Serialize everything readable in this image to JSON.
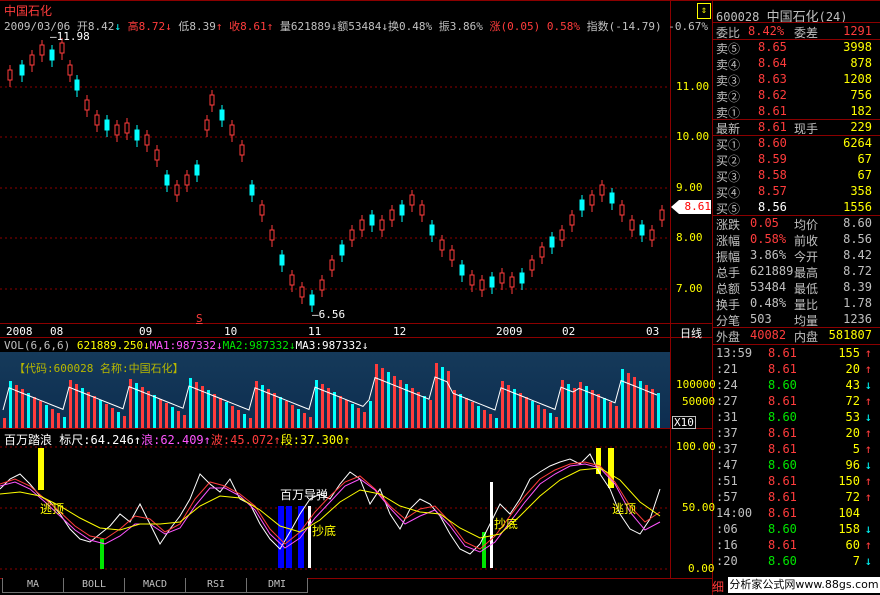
{
  "stock": {
    "name": "中国石化",
    "code": "600028",
    "title_right": "600028 中国石化(24)"
  },
  "info_bar": {
    "date": "2009/03/06",
    "open_label": "开",
    "open": "8.42",
    "high_label": "高",
    "high": "8.72",
    "low_label": "低",
    "low": "8.39",
    "close_label": "收",
    "close": "8.61",
    "vol_label": "量",
    "vol": "621889",
    "amount_label": "额",
    "amount": "53484",
    "turnover_label": "换",
    "turnover": "0.48%",
    "amplitude_label": "振",
    "amplitude": "3.86%",
    "change_label": "涨",
    "change": "(0.05)",
    "change_pct": "0.58%",
    "index_label": "指数",
    "index": "(-14.79)",
    "index_pct": "-0.67%"
  },
  "price_axis": [
    "11.00",
    "10.00",
    "9.00",
    "8.00",
    "7.00"
  ],
  "price_tag": "8.61",
  "annotations": {
    "max": "11.98",
    "min": "6.56",
    "s_mark": "S"
  },
  "date_axis": [
    "2008",
    "08",
    "09",
    "10",
    "11",
    "12",
    "2009",
    "02",
    "03"
  ],
  "period_label": "日线",
  "volume_header": {
    "title": "VOL(6,6,6)",
    "vol": "621889.250",
    "ma1_label": "MA1:",
    "ma1": "987332",
    "ma2_label": "MA2:",
    "ma2": "987332",
    "ma3_label": "MA3:",
    "ma3": "987332"
  },
  "volume_banner": "【代码:600028 名称:中国石化】",
  "volume_axis": [
    "100000",
    "50000"
  ],
  "volume_unit": "X10",
  "indicator_header": {
    "name": "百万踏浪",
    "ruler_label": "标尺:",
    "ruler": "64.246",
    "wave1_label": "浪:",
    "wave1": "62.409",
    "wave2_label": "波:",
    "wave2": "45.072",
    "seg_label": "段:",
    "seg": "37.300"
  },
  "indicator_axis": [
    "100.00",
    "50.00",
    "0.00"
  ],
  "indicator_labels": {
    "top_sell1": "逃顶",
    "mid_buy1": "百万导弹",
    "bottom1": "抄底",
    "bottom2": "抄底",
    "top_sell2": "逃顶"
  },
  "tabs": [
    "MA",
    "BOLL",
    "MACD",
    "RSI",
    "DMI"
  ],
  "order_book": {
    "ratio_label": "委比",
    "ratio": "8.42%",
    "diff_label": "委差",
    "diff": "1291",
    "asks": [
      {
        "label": "卖⑤",
        "price": "8.65",
        "vol": "3998"
      },
      {
        "label": "卖④",
        "price": "8.64",
        "vol": "878"
      },
      {
        "label": "卖③",
        "price": "8.63",
        "vol": "1208"
      },
      {
        "label": "卖②",
        "price": "8.62",
        "vol": "756"
      },
      {
        "label": "卖①",
        "price": "8.61",
        "vol": "182"
      }
    ],
    "last_label": "最新",
    "last": "8.61",
    "hand_label": "现手",
    "hand": "229",
    "bids": [
      {
        "label": "买①",
        "price": "8.60",
        "vol": "6264"
      },
      {
        "label": "买②",
        "price": "8.59",
        "vol": "67"
      },
      {
        "label": "买③",
        "price": "8.58",
        "vol": "67"
      },
      {
        "label": "买④",
        "price": "8.57",
        "vol": "358"
      },
      {
        "label": "买⑤",
        "price": "8.56",
        "vol": "1556"
      }
    ]
  },
  "stats": [
    {
      "l1": "涨跌",
      "v1": "0.05",
      "l2": "均价",
      "v2": "8.60"
    },
    {
      "l1": "涨幅",
      "v1": "0.58%",
      "l2": "前收",
      "v2": "8.56"
    },
    {
      "l1": "振幅",
      "v1": "3.86%",
      "l2": "今开",
      "v2": "8.42"
    },
    {
      "l1": "总手",
      "v1": "621889",
      "l2": "最高",
      "v2": "8.72"
    },
    {
      "l1": "总额",
      "v1": "53484",
      "l2": "最低",
      "v2": "8.39"
    },
    {
      "l1": "换手",
      "v1": "0.48%",
      "l2": "量比",
      "v2": "1.78"
    },
    {
      "l1": "分笔",
      "v1": "503",
      "l2": "均量",
      "v2": "1236"
    }
  ],
  "outer_label": "外盘",
  "outer": "40082",
  "inner_label": "内盘",
  "inner": "581807",
  "ticks": [
    {
      "t": "13:59",
      "p": "8.61",
      "v": "155",
      "d": "up"
    },
    {
      "t": ":21",
      "p": "8.61",
      "v": "20",
      "d": "up"
    },
    {
      "t": ":24",
      "p": "8.60",
      "v": "43",
      "d": "down"
    },
    {
      "t": ":27",
      "p": "8.61",
      "v": "72",
      "d": "up"
    },
    {
      "t": ":31",
      "p": "8.60",
      "v": "53",
      "d": "down"
    },
    {
      "t": ":37",
      "p": "8.61",
      "v": "20",
      "d": "up"
    },
    {
      "t": ":37",
      "p": "8.61",
      "v": "5",
      "d": "up"
    },
    {
      "t": ":47",
      "p": "8.60",
      "v": "96",
      "d": "down"
    },
    {
      "t": ":51",
      "p": "8.61",
      "v": "150",
      "d": "up"
    },
    {
      "t": ":57",
      "p": "8.61",
      "v": "72",
      "d": "up"
    },
    {
      "t": "14:00",
      "p": "8.61",
      "v": "104",
      "d": "none"
    },
    {
      "t": ":06",
      "p": "8.60",
      "v": "158",
      "d": "down"
    },
    {
      "t": ":16",
      "p": "8.61",
      "v": "60",
      "d": "up"
    },
    {
      "t": ":20",
      "p": "8.60",
      "v": "7",
      "d": "down"
    }
  ],
  "corner_label": "细",
  "watermark": "分析家公式网www.88gs.com",
  "colors": {
    "up": "#ff3c3c",
    "down": "#00ffff",
    "frame": "#8b0000",
    "bg": "#000000"
  }
}
